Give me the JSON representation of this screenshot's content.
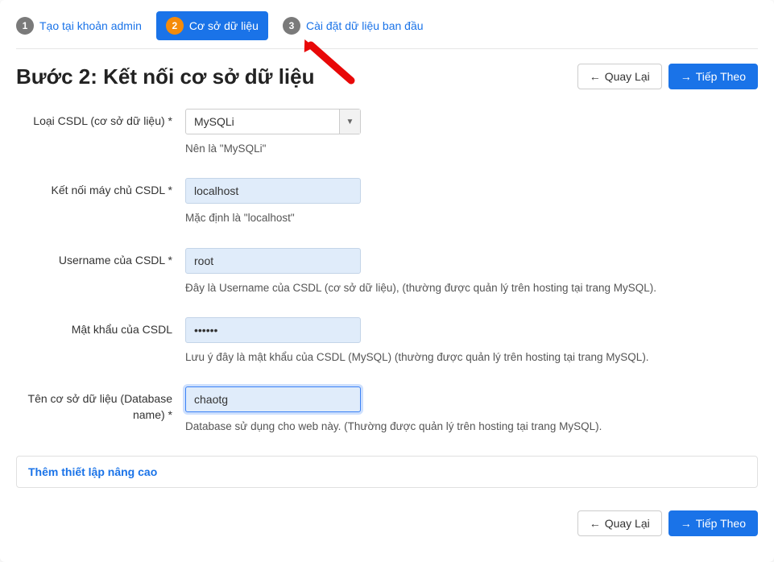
{
  "steps": {
    "s1": {
      "num": "1",
      "label": "Tạo tại khoản admin"
    },
    "s2": {
      "num": "2",
      "label": "Cơ sở dữ liệu"
    },
    "s3": {
      "num": "3",
      "label": "Cài đặt dữ liệu ban đầu"
    }
  },
  "page": {
    "title": "Bước 2: Kết nối cơ sở dữ liệu"
  },
  "buttons": {
    "back": "Quay Lại",
    "next": "Tiếp Theo"
  },
  "form": {
    "dbtype": {
      "label": "Loại CSDL (cơ sở dữ liệu) *",
      "value": "MySQLi",
      "hint": "Nên là \"MySQLi\""
    },
    "host": {
      "label": "Kết nối máy chủ CSDL *",
      "value": "localhost",
      "hint": "Mặc định là \"localhost\""
    },
    "user": {
      "label": "Username của CSDL *",
      "value": "root",
      "hint": "Đây là Username của CSDL (cơ sở dữ liệu), (thường được quản lý trên hosting tại trang MySQL)."
    },
    "pass": {
      "label": "Mật khẩu của CSDL",
      "value": "••••••",
      "hint": "Lưu ý đây là mật khẩu của CSDL (MySQL) (thường được quản lý trên hosting tại trang MySQL)."
    },
    "dbname": {
      "label": "Tên cơ sở dữ liệu (Database name) *",
      "value": "chaotg",
      "hint": "Database sử dụng cho web này. (Thường được quản lý trên hosting tại trang MySQL)."
    }
  },
  "advanced": {
    "label": "Thêm thiết lập nâng cao"
  }
}
